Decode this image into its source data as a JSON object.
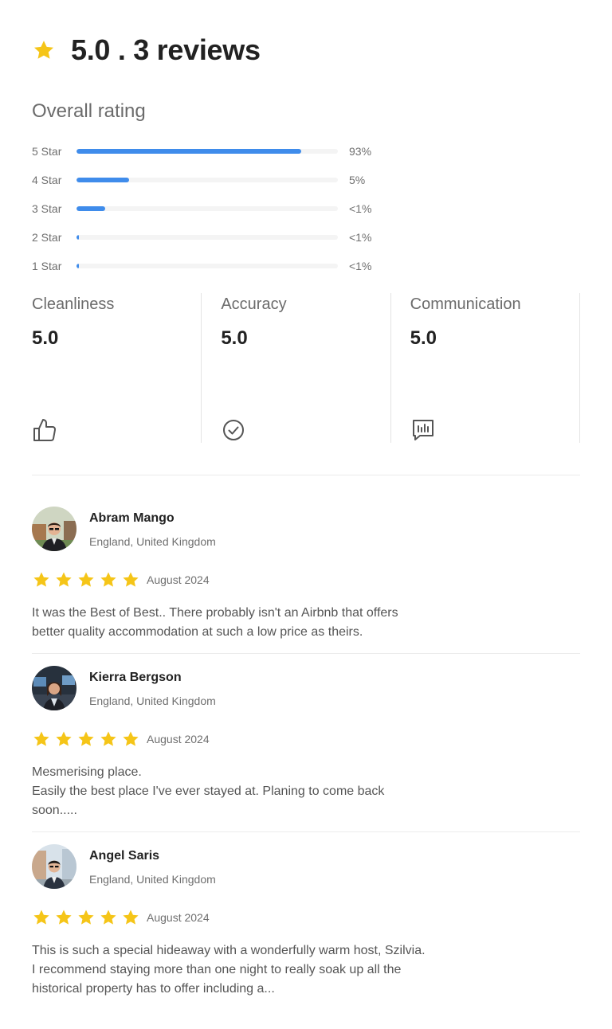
{
  "header": {
    "title": "5.0 . 3 reviews",
    "star_icon": "star-icon",
    "star_color": "#F5C518"
  },
  "overall": {
    "title": "Overall rating",
    "accent_color": "#3F8CEB",
    "bars": [
      {
        "label": "5 Star",
        "percent_text": "93%",
        "fill_fraction": 0.86
      },
      {
        "label": "4 Star",
        "percent_text": "5%",
        "fill_fraction": 0.2
      },
      {
        "label": "3 Star",
        "percent_text": "<1%",
        "fill_fraction": 0.11
      },
      {
        "label": "2 Star",
        "percent_text": "<1%",
        "fill_fraction": 0.01
      },
      {
        "label": "1 Star",
        "percent_text": "<1%",
        "fill_fraction": 0.01
      }
    ]
  },
  "categories": [
    {
      "name": "Cleanliness",
      "value": "5.0",
      "icon": "thumbs-up-icon"
    },
    {
      "name": "Accuracy",
      "value": "5.0",
      "icon": "check-circle-icon"
    },
    {
      "name": "Communication",
      "value": "5.0",
      "icon": "chart-message-icon"
    }
  ],
  "reviews": [
    {
      "name": "Abram Mango",
      "location": "England, United Kingdom",
      "stars": 5,
      "date": "August 2024",
      "text": "It was the Best of Best.. There probably isn't an Airbnb that offers\nbetter quality accommodation at such a low price as theirs."
    },
    {
      "name": "Kierra Bergson",
      "location": "England, United Kingdom",
      "stars": 5,
      "date": "August 2024",
      "text": "Mesmerising place.\nEasily the best place I've ever stayed at. Planing to come back\nsoon....."
    },
    {
      "name": "Angel Saris",
      "location": "England, United Kingdom",
      "stars": 5,
      "date": "August 2024",
      "text": "This is such a special hideaway with a wonderfully warm host, Szilvia.\nI recommend staying more than one night to really soak up all the\nhistorical property has to offer including a..."
    }
  ]
}
